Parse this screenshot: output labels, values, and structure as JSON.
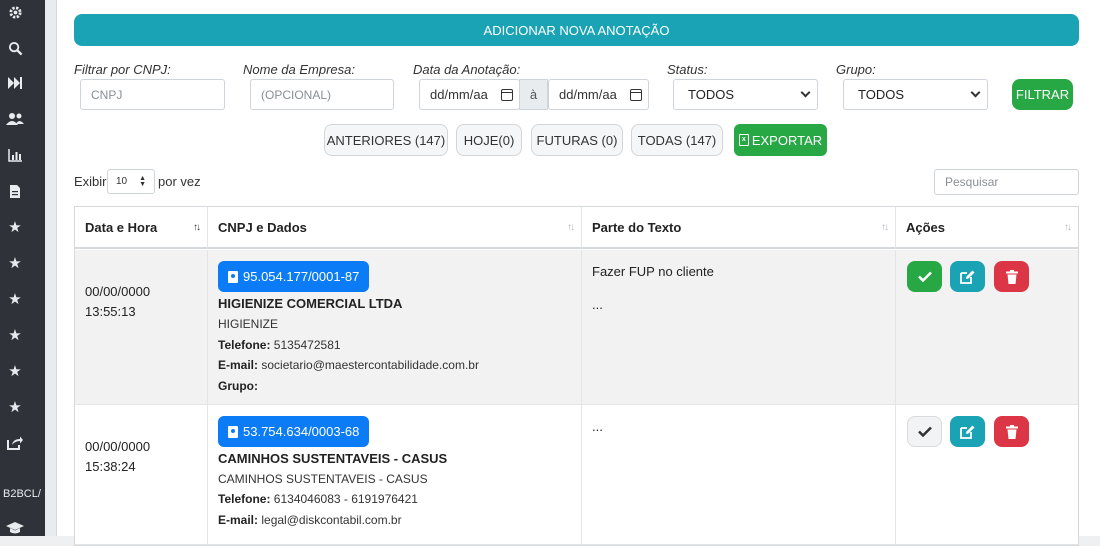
{
  "sidebar": {
    "icons": [
      "gear-icon",
      "search-icon",
      "fast-forward-icon",
      "users-icon",
      "chart-icon",
      "file-icon",
      "star-icon",
      "star-icon",
      "star-icon",
      "star-icon",
      "star-icon",
      "star-icon",
      "share-icon",
      "graduation-cap-icon"
    ],
    "brand_text": "B2BCL/"
  },
  "header": {
    "add_button_label": "ADICIONAR NOVA ANOTAÇÃO"
  },
  "filters": {
    "cnpj_label": "Filtrar por CNPJ:",
    "cnpj_placeholder": "CNPJ",
    "empresa_label": "Nome da Empresa:",
    "empresa_placeholder": "(OPCIONAL)",
    "data_label": "Data da Anotação:",
    "date_from_value": "dd/mm/aa",
    "date_separator": "à",
    "date_to_value": "dd/mm/aa",
    "status_label": "Status:",
    "status_value": "TODOS",
    "grupo_label": "Grupo:",
    "grupo_value": "TODOS",
    "filter_button": "FILTRAR"
  },
  "quick_filters": {
    "anteriores": "ANTERIORES (147)",
    "hoje": "HOJE(0)",
    "futuras": "FUTURAS (0)",
    "todas": "TODAS (147)",
    "exportar": "EXPORTAR"
  },
  "table_controls": {
    "show_label": "Exibir",
    "page_length": "10",
    "per_page_label": "por vez",
    "search_placeholder": "Pesquisar"
  },
  "table": {
    "headers": [
      "Data e Hora",
      "CNPJ e Dados",
      "Parte do Texto",
      "Ações"
    ],
    "rows": [
      {
        "date": "00/00/0000",
        "time": "13:55:13",
        "cnpj": "95.054.177/0001-87",
        "company": "HIGIENIZE COMERCIAL LTDA",
        "fantasy": "HIGIENIZE",
        "phone_label": "Telefone:",
        "phone": "5135472581",
        "email_label": "E-mail:",
        "email": "societario@maestercontabilidade.com.br",
        "group_label": "Grupo:",
        "text_line1": "Fazer FUP no cliente",
        "text_line2": "..."
      },
      {
        "date": "00/00/0000",
        "time": "15:38:24",
        "cnpj": "53.754.634/0003-68",
        "company": "CAMINHOS SUSTENTAVEIS - CASUS",
        "fantasy": "CAMINHOS SUSTENTAVEIS - CASUS",
        "phone_label": "Telefone:",
        "phone": "6134046083 - 6191976421",
        "email_label": "E-mail:",
        "email": "legal@diskcontabil.com.br",
        "text_line1": "..."
      }
    ]
  }
}
